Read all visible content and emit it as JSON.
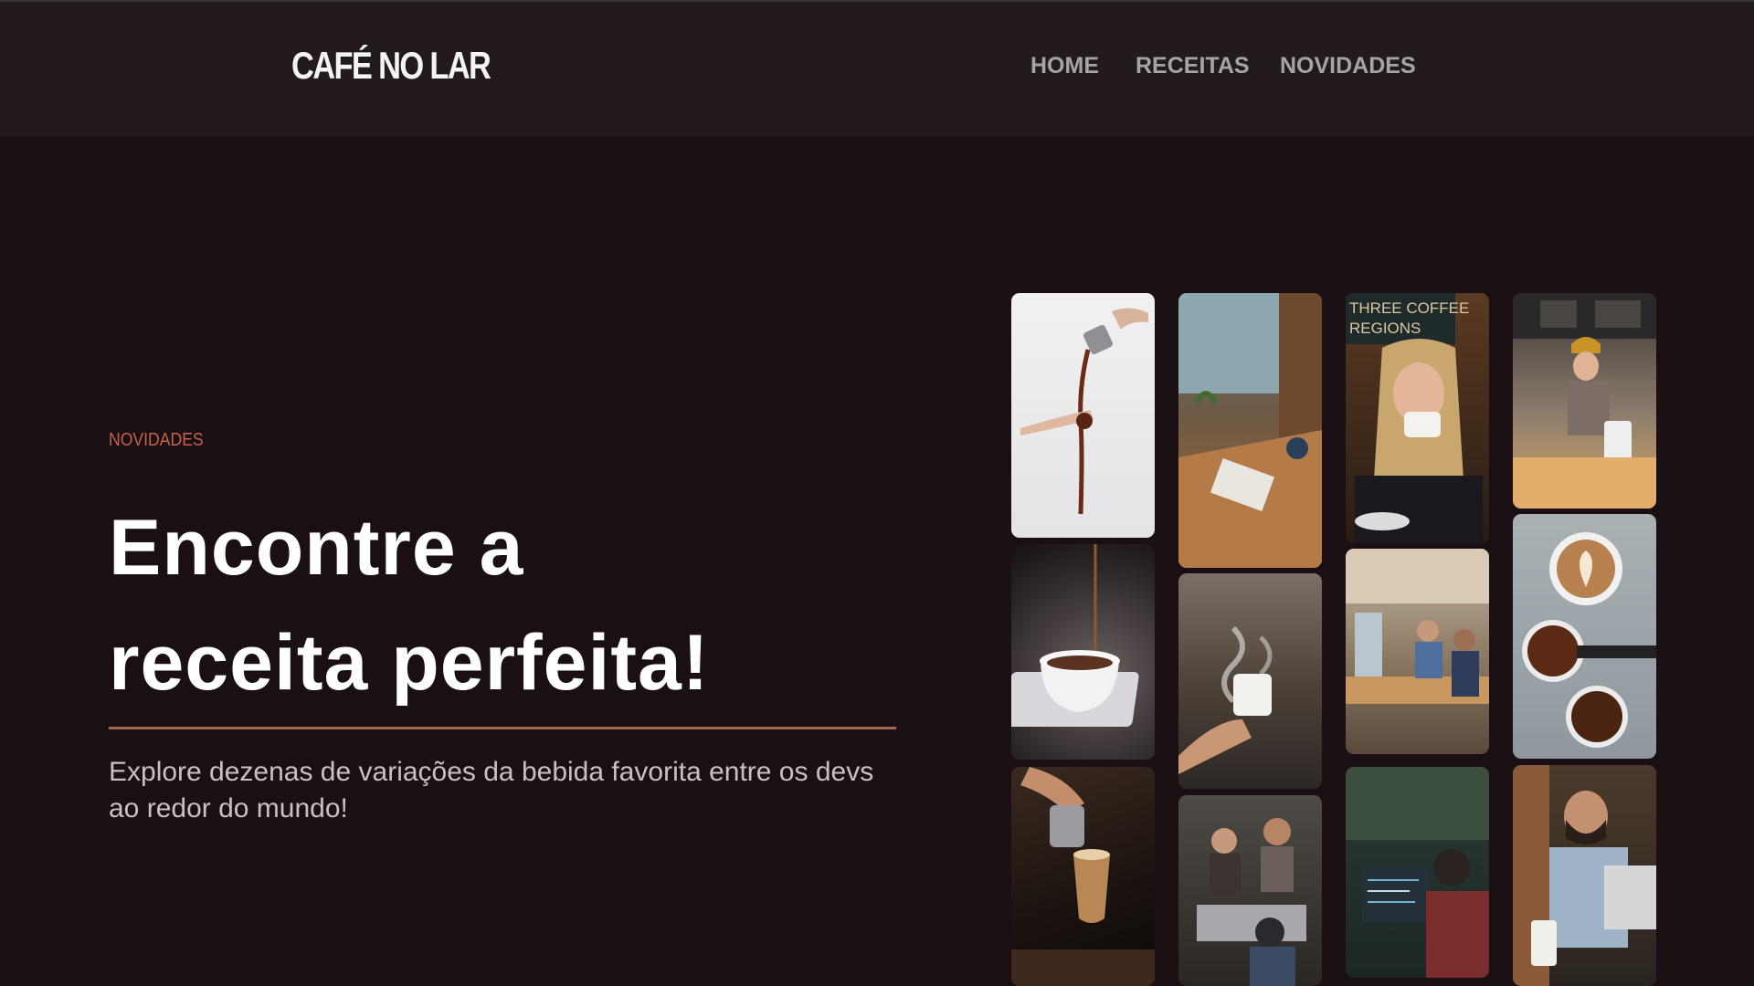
{
  "header": {
    "logo": "CAFÉ NO LAR",
    "nav": [
      {
        "label": "HOME"
      },
      {
        "label": "RECEITAS"
      },
      {
        "label": "NOVIDADES"
      }
    ]
  },
  "hero": {
    "eyebrow": "NOVIDADES",
    "title_line1": "Encontre a",
    "title_line2": "receita perfeita!",
    "description": "Explore dezenas de variações da bebida favorita entre os devs ao redor do mundo!"
  },
  "gallery": {
    "images": [
      {
        "name": "pour-over-photo",
        "label": "coffee pouring from pitcher into hand"
      },
      {
        "name": "cafe-window-table-photo",
        "label": "cafe table by window"
      },
      {
        "name": "woman-drinking-coffee-photo",
        "label": "THREE COFFEE REGIONS"
      },
      {
        "name": "barista-at-counter-photo",
        "label": "barista at counter"
      },
      {
        "name": "espresso-drip-cup-photo",
        "label": "espresso dripping into cup"
      },
      {
        "name": "steaming-mug-photo",
        "label": "steaming mug in hand"
      },
      {
        "name": "office-meeting-photo",
        "label": "people in office"
      },
      {
        "name": "latte-art-beans-photo",
        "label": "latte art and coffee beans"
      },
      {
        "name": "latte-pouring-photo",
        "label": "barista pouring milk"
      },
      {
        "name": "baristas-working-photo",
        "label": "baristas working"
      },
      {
        "name": "developers-coding-photo",
        "label": "developers at computers"
      },
      {
        "name": "man-laptop-coffee-photo",
        "label": "man with laptop and coffee"
      }
    ]
  },
  "colors": {
    "background": "#1a1013",
    "header": "#231a1b",
    "accent": "#c4614a",
    "divider": "#a3694f"
  }
}
